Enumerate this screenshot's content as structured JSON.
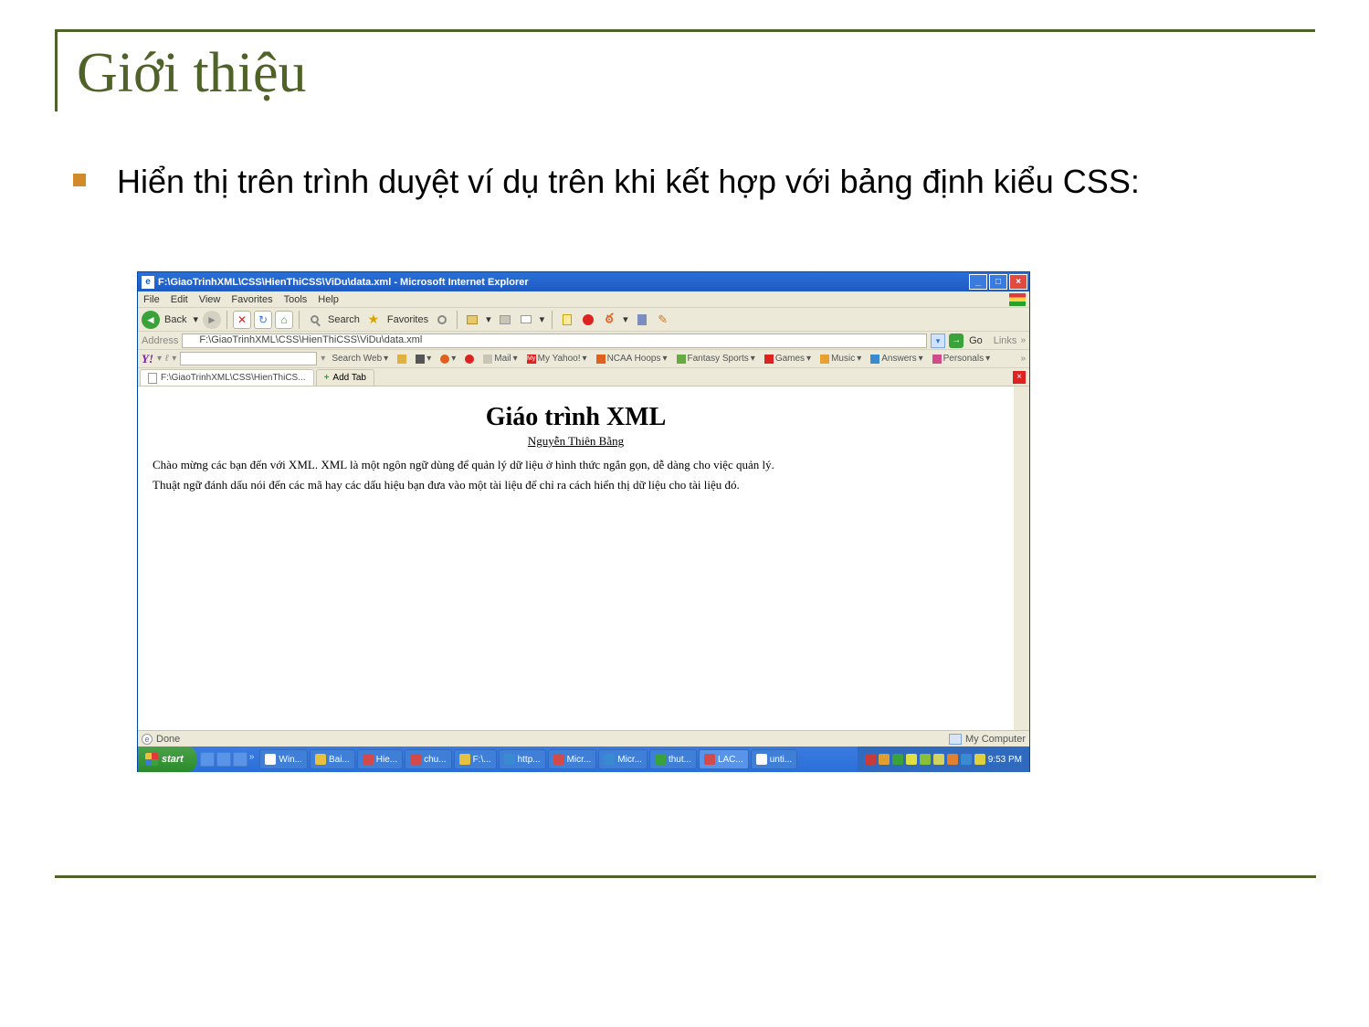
{
  "slide": {
    "title": "Giới thiệu",
    "bullet1": "Hiển thị trên trình duyệt ví dụ trên khi kết hợp với bảng định kiểu CSS:"
  },
  "ie": {
    "titlebar": "F:\\GiaoTrinhXML\\CSS\\HienThiCSS\\ViDu\\data.xml - Microsoft Internet Explorer",
    "menu": {
      "file": "File",
      "edit": "Edit",
      "view": "View",
      "favorites": "Favorites",
      "tools": "Tools",
      "help": "Help"
    },
    "toolbar": {
      "back": "Back",
      "search": "Search",
      "favorites": "Favorites"
    },
    "address": {
      "label": "Address",
      "value": "F:\\GiaoTrinhXML\\CSS\\HienThiCSS\\ViDu\\data.xml",
      "go": "Go",
      "links": "Links"
    },
    "yahoo": {
      "logo": "Y!",
      "searchweb": "Search Web",
      "mail": "Mail",
      "myyahoo": "My Yahoo!",
      "ncaa": "NCAA Hoops",
      "fantasy": "Fantasy Sports",
      "games": "Games",
      "music": "Music",
      "answers": "Answers",
      "personals": "Personals"
    },
    "tabs": {
      "tab1": "F:\\GiaoTrinhXML\\CSS\\HienThiCS...",
      "add": "Add Tab"
    },
    "page": {
      "heading": "Giáo trình XML",
      "author": "Nguyễn Thiên Bằng",
      "p1": "Chào mừng các bạn đến với XML. XML là một ngôn ngữ dùng để quản lý dữ liệu ở hình thức ngắn gọn, dễ dàng cho việc quản lý.",
      "p2": "Thuật ngữ đánh dấu nói đến các mã hay các dấu hiệu bạn đưa vào một tài liệu để chỉ ra cách hiển thị dữ liệu cho tài liệu đó."
    },
    "status": {
      "done": "Done",
      "mycomputer": "My Computer"
    }
  },
  "taskbar": {
    "start": "start",
    "items": [
      "Win...",
      "Bai...",
      "Hie...",
      "chu...",
      "F:\\...",
      "http...",
      "Micr...",
      "Micr...",
      "thut...",
      "LAC...",
      "unti..."
    ],
    "clock": "9:53 PM"
  }
}
